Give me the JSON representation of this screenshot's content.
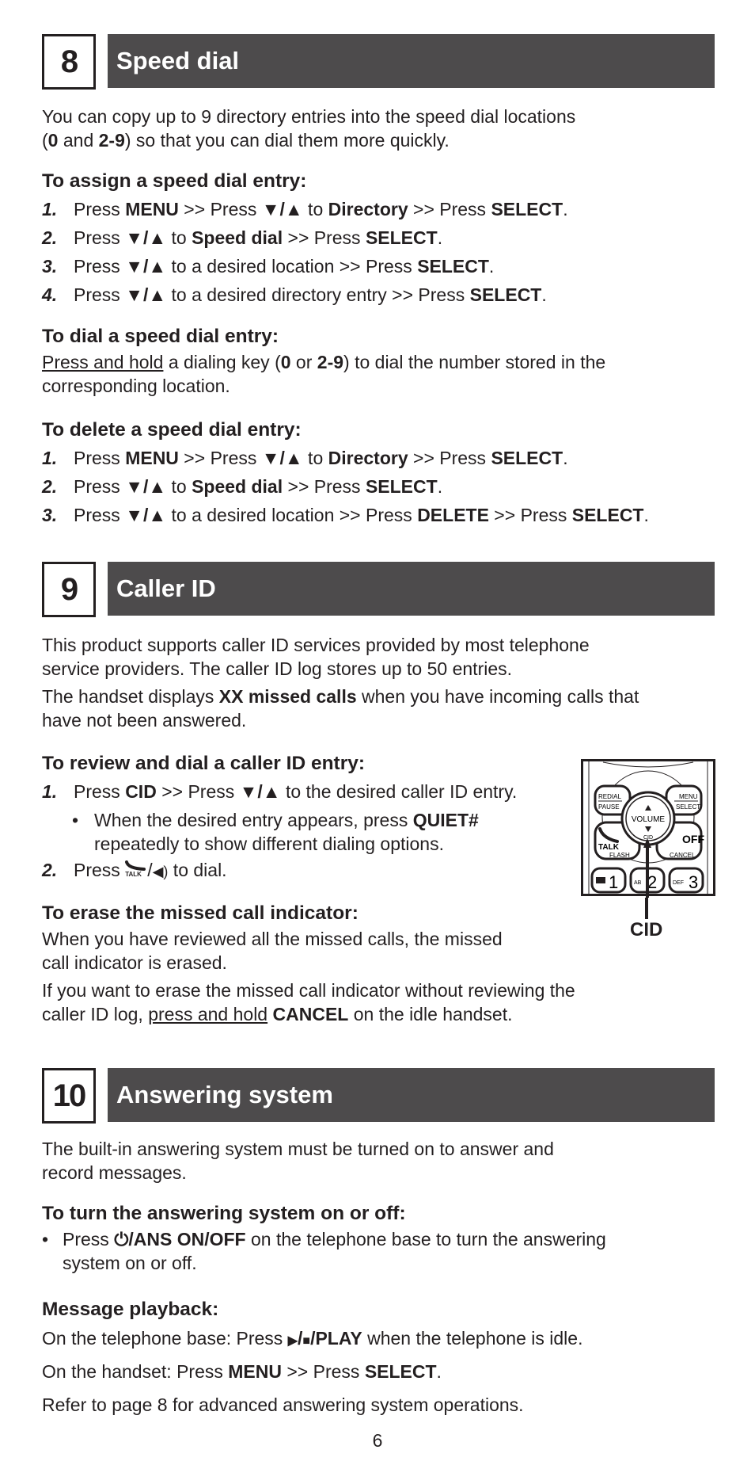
{
  "sections": [
    {
      "number": "8",
      "title": "Speed dial",
      "intro_a": "You can copy up to 9 directory entries into the speed dial locations",
      "intro_b_open": "(",
      "intro_b_0": "0",
      "intro_b_and": " and ",
      "intro_b_range": "2-9",
      "intro_b_rest": ") so that you can dial them more quickly.",
      "assign": {
        "heading": "To assign a speed dial entry:",
        "steps": [
          {
            "n": "1.",
            "t1": "Press ",
            "b1": "MENU",
            "t2": " >> Press ",
            "b2": "▼/▲",
            "t3": " to ",
            "b3": "Directory",
            "t4": " >> Press ",
            "b4": "SELECT",
            "t5": "."
          },
          {
            "n": "2.",
            "t1": "Press ",
            "b1": "▼/▲",
            "t2": " to ",
            "b2": "Speed dial",
            "t3": " >> Press ",
            "b3": "SELECT",
            "t4": "."
          },
          {
            "n": "3.",
            "t1": "Press ",
            "b1": "▼/▲",
            "t2": " to a desired location >> Press ",
            "b2": "SELECT",
            "t3": "."
          },
          {
            "n": "4.",
            "t1": "Press ",
            "b1": "▼/▲",
            "t2": " to a desired directory entry >> Press ",
            "b2": "SELECT",
            "t3": "."
          }
        ]
      },
      "dial": {
        "heading": "To dial a speed dial entry:",
        "u1": "Press and hold",
        "t1": " a dialing key (",
        "b1": "0",
        "t2": " or ",
        "b2": "2-9",
        "t3": ") to dial the number stored in the",
        "t4": "corresponding location."
      },
      "delete": {
        "heading": "To delete a speed dial entry:",
        "steps": [
          {
            "n": "1.",
            "t1": "Press ",
            "b1": "MENU",
            "t2": " >> Press ",
            "b2": "▼/▲",
            "t3": " to ",
            "b3": "Directory",
            "t4": " >> Press ",
            "b4": "SELECT",
            "t5": "."
          },
          {
            "n": "2.",
            "t1": "Press ",
            "b1": "▼/▲",
            "t2": " to ",
            "b2": "Speed dial",
            "t3": " >> Press ",
            "b3": "SELECT",
            "t4": "."
          },
          {
            "n": "3.",
            "t1": "Press ",
            "b1": "▼/▲",
            "t2": " to a desired location >> Press ",
            "b2": "DELETE",
            "t3": " >> Press ",
            "b3": "SELECT",
            "t4": "."
          }
        ]
      }
    },
    {
      "number": "9",
      "title": "Caller ID",
      "p1a": "This product supports caller ID services provided by most telephone",
      "p1b": "service providers. The caller ID log stores up to 50 entries.",
      "p2_t1": "The handset displays ",
      "p2_b1": "XX missed calls",
      "p2_t2": " when you have incoming calls that",
      "p2_t3": "have not been answered.",
      "review": {
        "heading": "To review and dial a caller ID entry:",
        "s1": {
          "n": "1.",
          "t1": "Press ",
          "b1": "CID",
          "t2": " >> Press ",
          "b2": "▼/▲",
          "t3": " to the desired caller ID entry."
        },
        "bullet": {
          "t1": "When the desired entry appears, press ",
          "b1": "QUIET#",
          "t2": "repeatedly to show different dialing options."
        },
        "s2": {
          "n": "2.",
          "t1": "Press ",
          "icon_label": "TALK",
          "sep": "/",
          "t2": " to dial."
        }
      },
      "erase": {
        "heading": "To erase the missed call indicator:",
        "p1a": "When you have reviewed all the missed calls, the missed",
        "p1b": "call indicator is erased.",
        "p2a": "If you want to erase the missed call indicator without reviewing the",
        "p2b_t1": "caller ID log, ",
        "p2b_u": "press and hold",
        "p2b_t2": " ",
        "p2b_b": "CANCEL",
        "p2b_t3": " on the idle handset."
      },
      "figure": {
        "callout": "CID",
        "keys": {
          "redial": "REDIAL",
          "pause": "PAUSE",
          "menu": "MENU",
          "select": "SELECT",
          "volume": "VOLUME",
          "cid": "CID",
          "talk": "TALK",
          "flash": "FLASH",
          "off": "OFF",
          "cancel": "CANCEL",
          "k1": "1",
          "k2": "2",
          "k3": "3",
          "abc": "AB",
          "def": "DEF"
        }
      }
    },
    {
      "number": "10",
      "title": "Answering system",
      "p1a": "The built-in answering system must be turned on to answer and",
      "p1b": "record messages.",
      "onoff": {
        "heading": "To turn the answering system on or off:",
        "t1": "Press ",
        "b1": "/ANS ON/OFF",
        "t2": " on the telephone base to turn the answering",
        "t3": "system on or off."
      },
      "playback": {
        "heading": "Message playback:",
        "l1_t1": "On the telephone base: Press ",
        "l1_b1": "/PLAY",
        "l1_t2": " when the telephone is idle.",
        "l2_t1": "On the handset: Press ",
        "l2_b1": "MENU",
        "l2_t2": " >> Press ",
        "l2_b2": "SELECT",
        "l2_t3": "."
      },
      "refer": "Refer to page 8 for advanced answering system operations."
    }
  ],
  "page_number": "6"
}
